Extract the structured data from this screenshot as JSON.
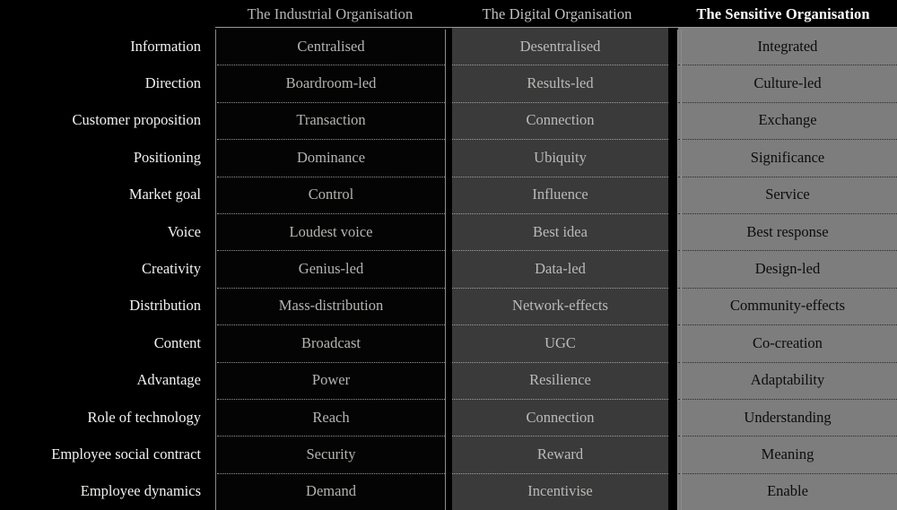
{
  "table": {
    "corner_label": "",
    "columns": [
      {
        "id": "industrial",
        "header": "The Industrial Organisation",
        "style": "dark",
        "bg": "#040404",
        "fg": "#b6b4b1"
      },
      {
        "id": "digital",
        "header": "The Digital Organisation",
        "style": "mid",
        "bg": "#3a3a3a",
        "fg": "#bcbab8"
      },
      {
        "id": "sensitive",
        "header": "The Sensitive Organisation",
        "style": "light",
        "bg": "#7d7d7d",
        "fg": "#0c0c0c"
      }
    ],
    "rows": [
      {
        "label": "Information",
        "cells": [
          "Centralised",
          "Desentralised",
          "Integrated"
        ]
      },
      {
        "label": "Direction",
        "cells": [
          "Boardroom-led",
          "Results-led",
          "Culture-led"
        ]
      },
      {
        "label": "Customer proposition",
        "cells": [
          "Transaction",
          "Connection",
          "Exchange"
        ]
      },
      {
        "label": "Positioning",
        "cells": [
          "Dominance",
          "Ubiquity",
          "Significance"
        ]
      },
      {
        "label": "Market goal",
        "cells": [
          "Control",
          "Influence",
          "Service"
        ]
      },
      {
        "label": "Voice",
        "cells": [
          "Loudest voice",
          "Best idea",
          "Best response"
        ]
      },
      {
        "label": "Creativity",
        "cells": [
          "Genius-led",
          "Data-led",
          "Design-led"
        ]
      },
      {
        "label": "Distribution",
        "cells": [
          "Mass-distribution",
          "Network-effects",
          "Community-effects"
        ]
      },
      {
        "label": "Content",
        "cells": [
          "Broadcast",
          "UGC",
          "Co-creation"
        ]
      },
      {
        "label": "Advantage",
        "cells": [
          "Power",
          "Resilience",
          "Adaptability"
        ]
      },
      {
        "label": "Role of technology",
        "cells": [
          "Reach",
          "Connection",
          "Understanding"
        ]
      },
      {
        "label": "Employee social contract",
        "cells": [
          "Security",
          "Reward",
          "Meaning"
        ]
      },
      {
        "label": "Employee dynamics",
        "cells": [
          "Demand",
          "Incentivise",
          "Enable"
        ]
      }
    ]
  },
  "theme": {
    "page_bg": "#000000",
    "rule_color": "#9c9a98",
    "label_color": "#f2f1ef",
    "header_highlight_color": "#ffffff"
  }
}
